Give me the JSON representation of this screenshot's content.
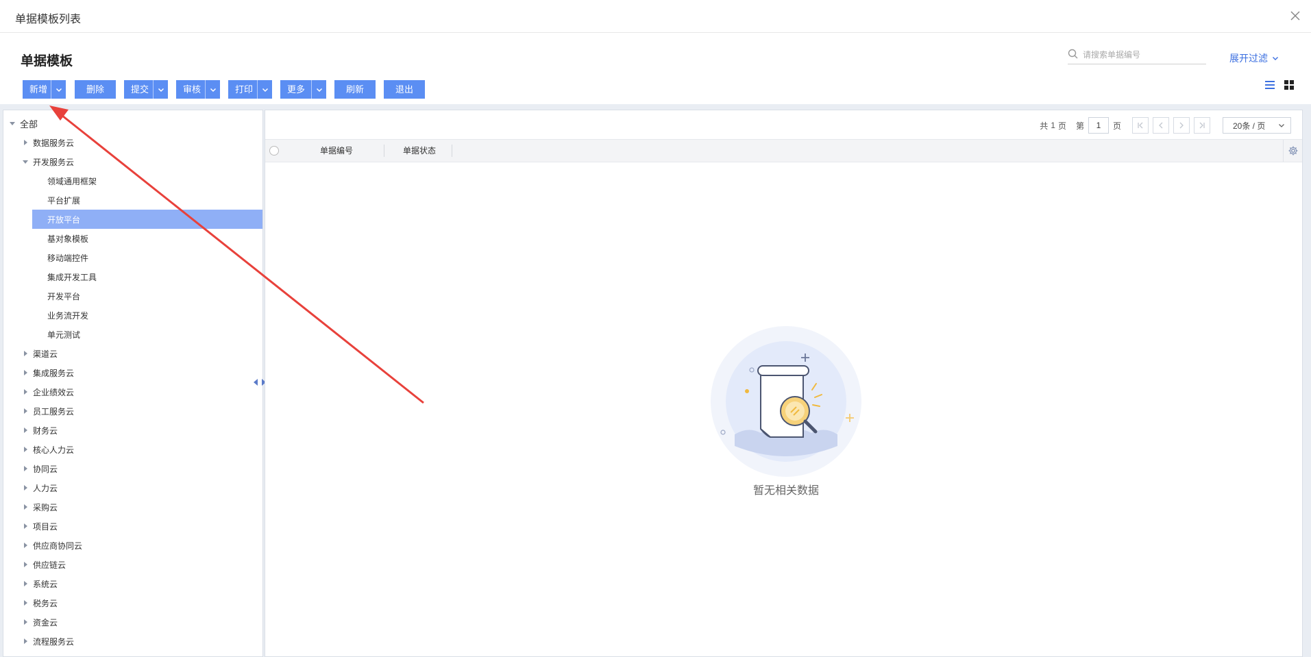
{
  "window": {
    "title": "单据模板列表"
  },
  "page": {
    "title": "单据模板"
  },
  "search": {
    "placeholder": "请搜索单据编号"
  },
  "filter": {
    "expand_label": "展开过滤"
  },
  "toolbar": {
    "add_label": "新增",
    "delete_label": "删除",
    "submit_label": "提交",
    "audit_label": "审核",
    "print_label": "打印",
    "more_label": "更多",
    "refresh_label": "刷新",
    "exit_label": "退出"
  },
  "tree": {
    "root": "全部",
    "items": [
      {
        "label": "数据服务云",
        "level": 1,
        "expanded": false,
        "selected": false
      },
      {
        "label": "开发服务云",
        "level": 1,
        "expanded": true,
        "selected": false
      },
      {
        "label": "领域通用框架",
        "level": 2,
        "selected": false
      },
      {
        "label": "平台扩展",
        "level": 2,
        "selected": false
      },
      {
        "label": "开放平台",
        "level": 2,
        "selected": true
      },
      {
        "label": "基对象模板",
        "level": 2,
        "selected": false
      },
      {
        "label": "移动端控件",
        "level": 2,
        "selected": false
      },
      {
        "label": "集成开发工具",
        "level": 2,
        "selected": false
      },
      {
        "label": "开发平台",
        "level": 2,
        "selected": false
      },
      {
        "label": "业务流开发",
        "level": 2,
        "selected": false
      },
      {
        "label": "单元测试",
        "level": 2,
        "selected": false
      },
      {
        "label": "渠道云",
        "level": 1,
        "expanded": false,
        "selected": false
      },
      {
        "label": "集成服务云",
        "level": 1,
        "expanded": false,
        "selected": false
      },
      {
        "label": "企业绩效云",
        "level": 1,
        "expanded": false,
        "selected": false
      },
      {
        "label": "员工服务云",
        "level": 1,
        "expanded": false,
        "selected": false
      },
      {
        "label": "财务云",
        "level": 1,
        "expanded": false,
        "selected": false
      },
      {
        "label": "核心人力云",
        "level": 1,
        "expanded": false,
        "selected": false
      },
      {
        "label": "协同云",
        "level": 1,
        "expanded": false,
        "selected": false
      },
      {
        "label": "人力云",
        "level": 1,
        "expanded": false,
        "selected": false
      },
      {
        "label": "采购云",
        "level": 1,
        "expanded": false,
        "selected": false
      },
      {
        "label": "项目云",
        "level": 1,
        "expanded": false,
        "selected": false
      },
      {
        "label": "供应商协同云",
        "level": 1,
        "expanded": false,
        "selected": false
      },
      {
        "label": "供应链云",
        "level": 1,
        "expanded": false,
        "selected": false
      },
      {
        "label": "系统云",
        "level": 1,
        "expanded": false,
        "selected": false
      },
      {
        "label": "税务云",
        "level": 1,
        "expanded": false,
        "selected": false
      },
      {
        "label": "资金云",
        "level": 1,
        "expanded": false,
        "selected": false
      },
      {
        "label": "流程服务云",
        "level": 1,
        "expanded": false,
        "selected": false
      }
    ]
  },
  "pager": {
    "total_prefix": "共",
    "total_pages": "1",
    "total_suffix": "页",
    "page_prefix": "第",
    "current_page": "1",
    "page_suffix": "页",
    "page_size": "20条 / 页"
  },
  "grid": {
    "columns": [
      "单据编号",
      "单据状态"
    ],
    "empty_text": "暂无相关数据"
  },
  "colors": {
    "primary_button": "#5b8ef3",
    "selected_tree_item": "#8faff6",
    "link": "#3b6fe0",
    "annotation_arrow": "#e8413b"
  },
  "icons": {
    "close": "close-icon",
    "search": "search-icon",
    "chevron_down": "chevron-down-icon",
    "list_view": "list-view-icon",
    "card_view": "grid-view-icon",
    "gear": "gear-icon",
    "empty_state": "empty-scroll-magnifier-illustration"
  }
}
